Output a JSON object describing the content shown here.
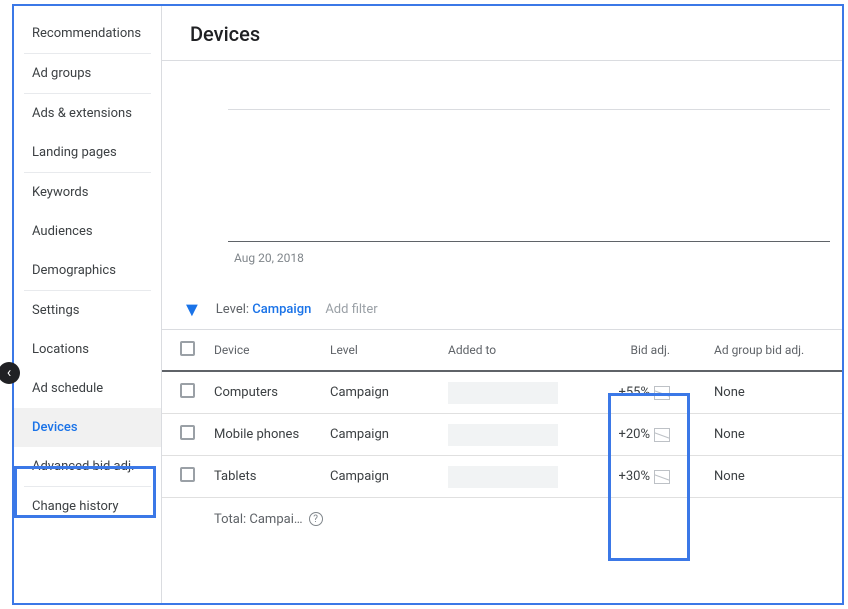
{
  "page_title": "Devices",
  "sidebar": {
    "groups": [
      [
        "Recommendations"
      ],
      [
        "Ad groups"
      ],
      [
        "Ads & extensions",
        "Landing pages"
      ],
      [
        "Keywords",
        "Audiences",
        "Demographics"
      ],
      [
        "Settings",
        "Locations",
        "Ad schedule",
        "Devices",
        "Advanced bid adj."
      ],
      [
        "Change history"
      ]
    ],
    "active": "Devices"
  },
  "chart": {
    "date_label": "Aug 20, 2018"
  },
  "filter": {
    "level_prefix": "Level: ",
    "level_value": "Campaign",
    "add_filter": "Add filter"
  },
  "table": {
    "headers": {
      "device": "Device",
      "level": "Level",
      "added_to": "Added to",
      "bid_adj": "Bid adj.",
      "adgroup_bid_adj": "Ad group bid adj."
    },
    "rows": [
      {
        "device": "Computers",
        "level": "Campaign",
        "bid_adj": "+55%",
        "adgroup": "None"
      },
      {
        "device": "Mobile phones",
        "level": "Campaign",
        "bid_adj": "+20%",
        "adgroup": "None"
      },
      {
        "device": "Tablets",
        "level": "Campaign",
        "bid_adj": "+30%",
        "adgroup": "None"
      }
    ],
    "footer_label": "Total: Campai…"
  }
}
